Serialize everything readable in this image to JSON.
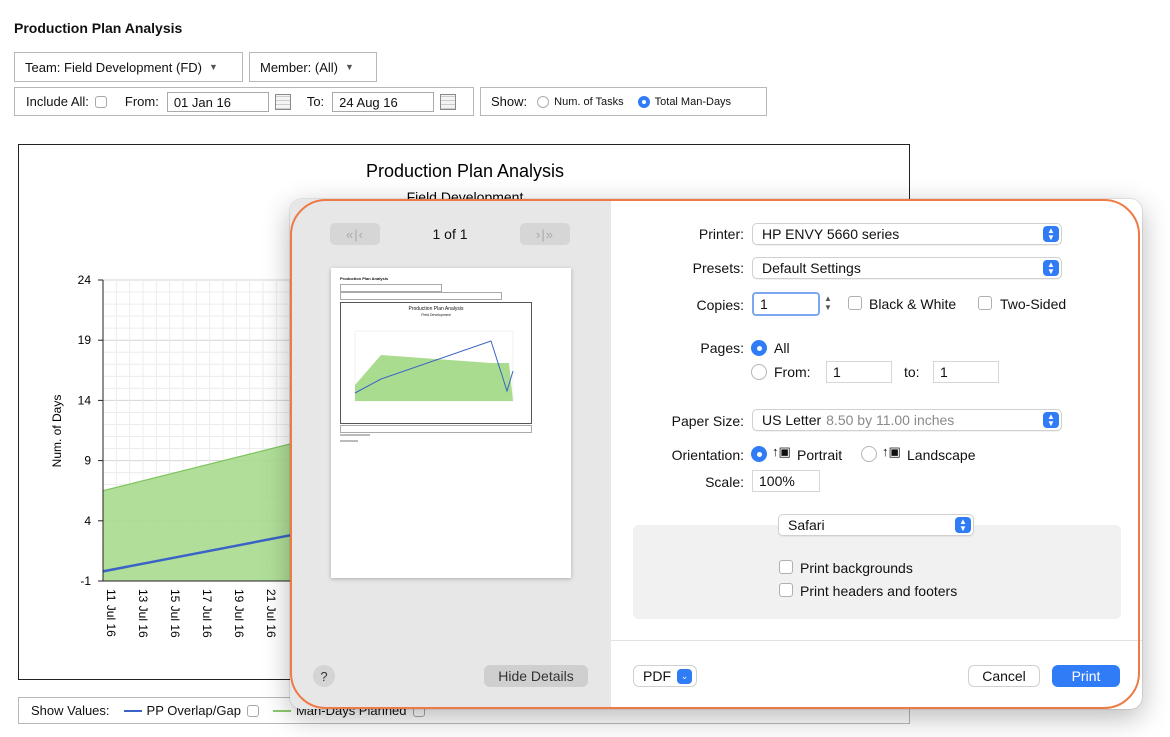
{
  "page": {
    "title": "Production Plan Analysis"
  },
  "filters": {
    "team_label": "Team: Field Development (FD)",
    "member_label": "Member: (All)",
    "include_all_label": "Include All:",
    "from_label": "From:",
    "from_value": "01 Jan 16",
    "to_label": "To:",
    "to_value": "24 Aug 16",
    "show_label": "Show:",
    "opt_tasks": "Num. of Tasks",
    "opt_mandays": "Total Man-Days",
    "selected": "Total Man-Days"
  },
  "chart_data": {
    "type": "area",
    "title": "Production Plan Analysis",
    "subtitle": "Field Development",
    "ylabel": "Num. of Days",
    "ylim": [
      -1,
      24
    ],
    "yticks": [
      24,
      19,
      14,
      9,
      4,
      -1
    ],
    "categories": [
      "11 Jul 16",
      "13 Jul 16",
      "15 Jul 16",
      "17 Jul 16",
      "19 Jul 16",
      "21 Jul 16"
    ],
    "x": [
      0,
      10
    ],
    "series": [
      {
        "name": "Man-Days Planned",
        "type": "area",
        "values": [
          [
            0,
            6.5
          ],
          [
            5,
            14.8
          ],
          [
            6,
            14.5
          ]
        ],
        "color": "#a9dc8e"
      },
      {
        "name": "PP Overlap/Gap",
        "type": "line",
        "values": [
          [
            0,
            -0.2
          ],
          [
            5,
            6.2
          ],
          [
            6,
            7.2
          ]
        ],
        "color": "#3a63c8"
      }
    ],
    "grid": true
  },
  "legend": {
    "show_values_label": "Show Values:",
    "pp_label": "PP Overlap/Gap",
    "md_label": "Man-Days Planned"
  },
  "dialog": {
    "page_counter": "1 of 1",
    "hide_details": "Hide Details",
    "help": "?",
    "printer_label": "Printer:",
    "printer_value": "HP ENVY 5660 series",
    "presets_label": "Presets:",
    "presets_value": "Default Settings",
    "copies_label": "Copies:",
    "copies_value": "1",
    "bw_label": "Black & White",
    "two_sided_label": "Two-Sided",
    "pages_label": "Pages:",
    "all_label": "All",
    "from_label": "From:",
    "from_value": "1",
    "to_label": "to:",
    "to_value": "1",
    "paper_label": "Paper Size:",
    "paper_value": "US Letter",
    "paper_detail": "8.50 by 11.00 inches",
    "orientation_label": "Orientation:",
    "portrait_label": "Portrait",
    "landscape_label": "Landscape",
    "scale_label": "Scale:",
    "scale_value": "100%",
    "app_section": "Safari",
    "print_backgrounds": "Print backgrounds",
    "print_headers": "Print headers and footers",
    "pdf_label": "PDF",
    "cancel_label": "Cancel",
    "print_label": "Print"
  },
  "preview": {
    "title": "Production Plan Analysis",
    "chart_title": "Production Plan Analysis",
    "chart_subtitle": "Field Development"
  },
  "colors": {
    "accent": "#2f7cf6",
    "highlight": "#ee7a45",
    "area": "#a9dc8e",
    "line": "#3a63c8"
  }
}
